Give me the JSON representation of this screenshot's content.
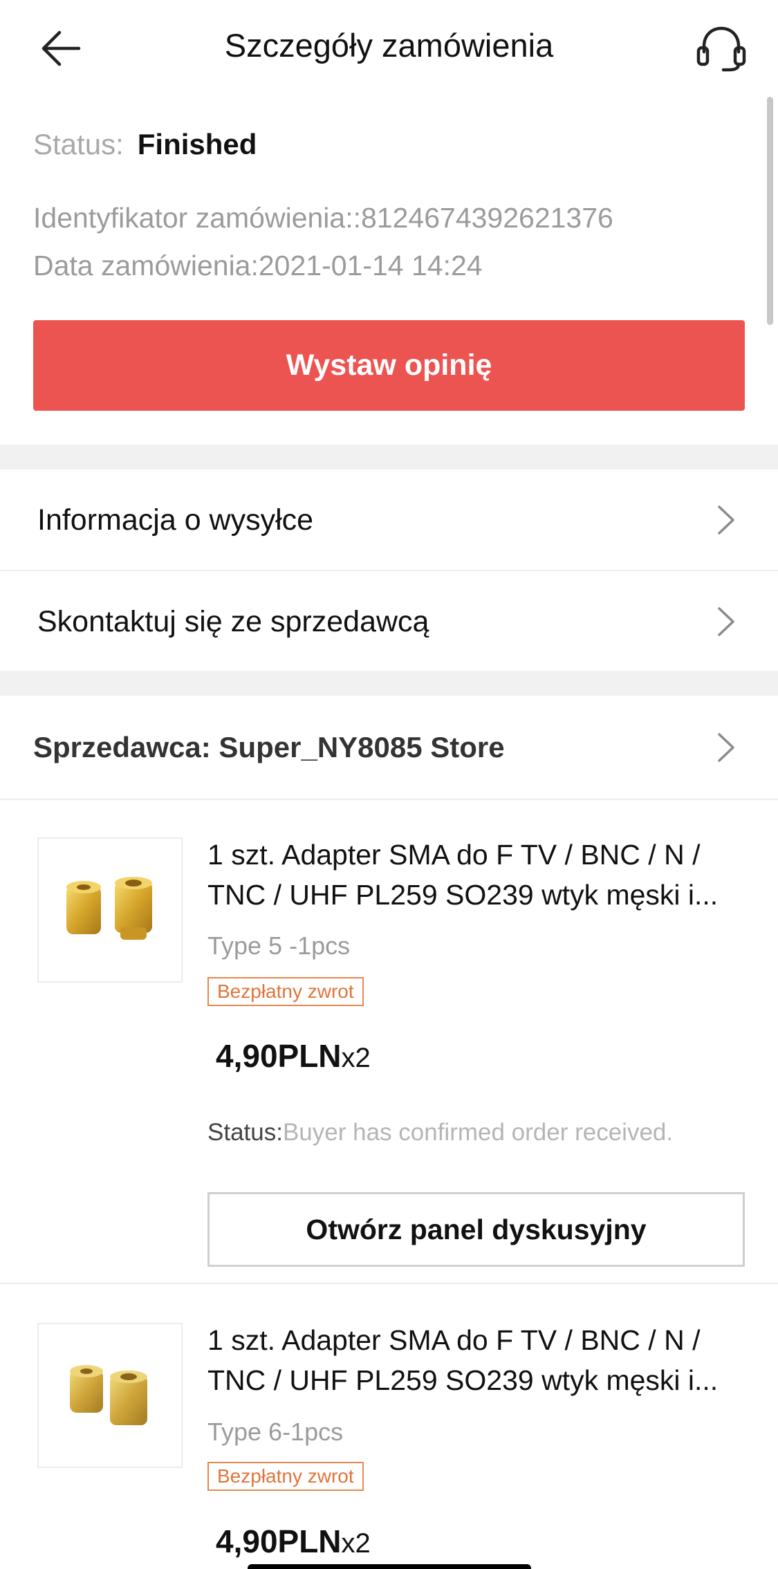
{
  "header": {
    "title": "Szczegóły zamówienia",
    "back_icon": "arrow-left-icon",
    "support_icon": "headset-icon"
  },
  "order": {
    "status_label": "Status:",
    "status_value": "Finished",
    "id_line": "Identyfikator zamówienia::8124674392621376",
    "date_line": "Data zamówienia:2021-01-14 14:24",
    "review_button": "Wystaw opinię"
  },
  "nav": {
    "shipping_info": "Informacja o wysyłce",
    "contact_seller": "Skontaktuj się ze sprzedawcą"
  },
  "seller": {
    "label": "Sprzedawca: Super_NY8085 Store"
  },
  "items": [
    {
      "title": "1 szt. Adapter SMA do F TV / BNC / N / TNC / UHF PL259 SO239 wtyk męski i...",
      "variant": "Type 5 -1pcs",
      "tag": "Bezpłatny zwrot",
      "price": "4,90PLN",
      "qty": "x2",
      "status_label": "Status:",
      "status_value": "Buyer has confirmed order received.",
      "dispute_button": "Otwórz panel dyskusyjny"
    },
    {
      "title": "1 szt. Adapter SMA do F TV / BNC / N / TNC / UHF PL259 SO239 wtyk męski i...",
      "variant": "Type 6-1pcs",
      "tag": "Bezpłatny zwrot",
      "price": "4,90PLN",
      "qty": "x2"
    }
  ],
  "colors": {
    "accent": "#ec5452",
    "tag": "#e0743a",
    "separator": "#f1f1f1"
  }
}
